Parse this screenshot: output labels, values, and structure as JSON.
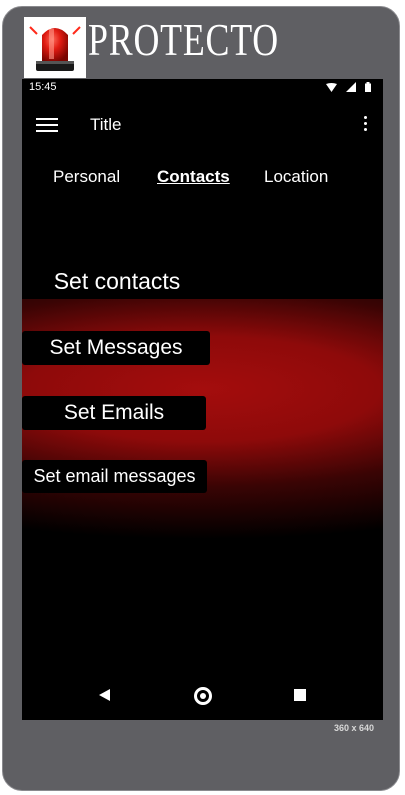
{
  "brand": {
    "name": "PROTECTO",
    "logo_icon": "siren-icon"
  },
  "status_bar": {
    "time": "15:45",
    "icons": [
      "wifi-icon",
      "signal-icon",
      "battery-icon"
    ]
  },
  "app_bar": {
    "title": "Title",
    "menu_icon": "hamburger-menu-icon",
    "overflow_icon": "more-vert-icon"
  },
  "tabs": [
    {
      "label": "Personal",
      "active": false
    },
    {
      "label": "Contacts",
      "active": true
    },
    {
      "label": "Location",
      "active": false
    }
  ],
  "buttons": {
    "set_contacts": "Set contacts",
    "set_messages": "Set Messages",
    "set_emails": "Set Emails",
    "set_email_messages": "Set email messages"
  },
  "nav_bar": {
    "back_icon": "back-triangle-icon",
    "home_icon": "home-circle-icon",
    "recents_icon": "recents-square-icon"
  },
  "device_size": "360 x 640",
  "colors": {
    "frame": "#5f5f63",
    "screen": "#000000",
    "accent_red": "#a40d0d"
  }
}
